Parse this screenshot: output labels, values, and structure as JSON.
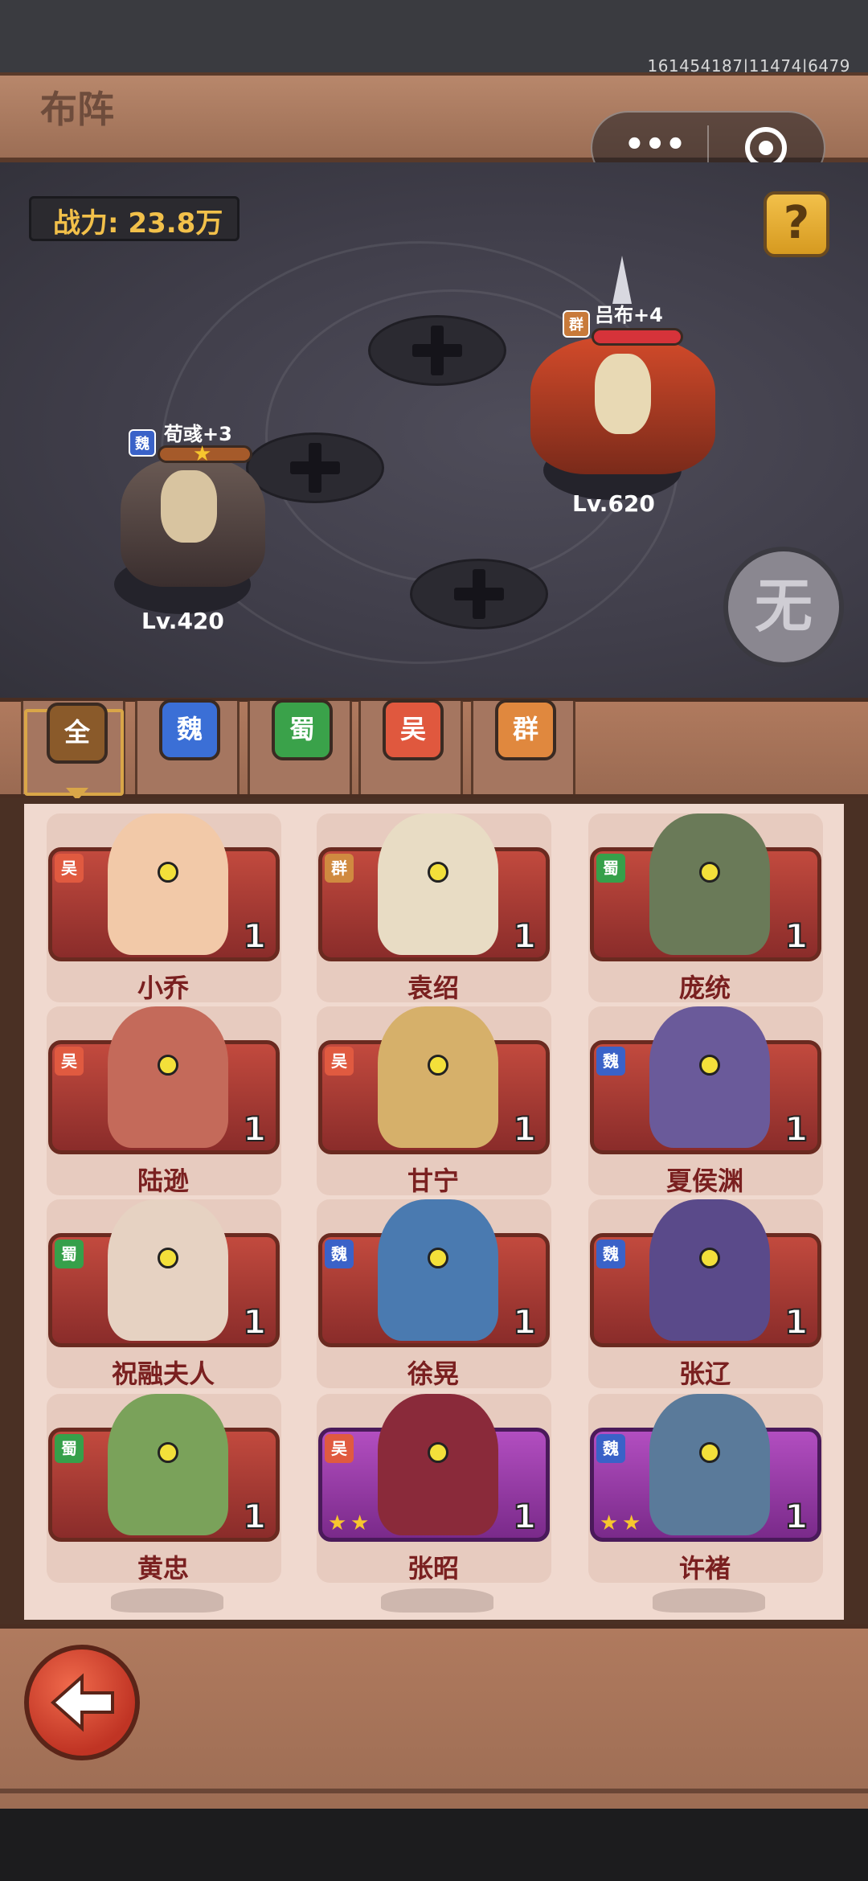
{
  "debug": {
    "text": "161454187|11474|6479"
  },
  "header": {
    "title": "布阵"
  },
  "capsule": {
    "more_glyph": "•••"
  },
  "battle": {
    "power_label": "战力: 23.8万",
    "help_glyph": "?",
    "seal_glyph": "无",
    "heroes": [
      {
        "name": "荀彧+3",
        "faction": "魏",
        "level": "Lv.420",
        "stars": 1,
        "faction_color": "#3a62c8"
      },
      {
        "name": "吕布+4",
        "faction": "群",
        "level": "Lv.620",
        "stars": 0,
        "faction_color": "#c87a3a"
      }
    ]
  },
  "tabs": [
    {
      "label": "全",
      "color": "#8a5a2a",
      "selected": true
    },
    {
      "label": "魏",
      "color": "#3b6fd6"
    },
    {
      "label": "蜀",
      "color": "#3aa24a"
    },
    {
      "label": "吴",
      "color": "#e0583e"
    },
    {
      "label": "群",
      "color": "#e0883e"
    }
  ],
  "faction_colors": {
    "魏": "#3a62c8",
    "蜀": "#36a04a",
    "吴": "#e05a40",
    "群": "#d08a40"
  },
  "cards": [
    {
      "name": "小乔",
      "faction": "吴",
      "count": "1",
      "stars": 0,
      "style": "red"
    },
    {
      "name": "袁绍",
      "faction": "群",
      "count": "1",
      "stars": 0,
      "style": "red"
    },
    {
      "name": "庞统",
      "faction": "蜀",
      "count": "1",
      "stars": 0,
      "style": "red"
    },
    {
      "name": "陆逊",
      "faction": "吴",
      "count": "1",
      "stars": 0,
      "style": "red"
    },
    {
      "name": "甘宁",
      "faction": "吴",
      "count": "1",
      "stars": 0,
      "style": "red"
    },
    {
      "name": "夏侯渊",
      "faction": "魏",
      "count": "1",
      "stars": 0,
      "style": "red"
    },
    {
      "name": "祝融夫人",
      "faction": "蜀",
      "count": "1",
      "stars": 0,
      "style": "red"
    },
    {
      "name": "徐晃",
      "faction": "魏",
      "count": "1",
      "stars": 0,
      "style": "red"
    },
    {
      "name": "张辽",
      "faction": "魏",
      "count": "1",
      "stars": 0,
      "style": "red"
    },
    {
      "name": "黄忠",
      "faction": "蜀",
      "count": "1",
      "stars": 0,
      "style": "red"
    },
    {
      "name": "张昭",
      "faction": "吴",
      "count": "1",
      "stars": 2,
      "style": "purple"
    },
    {
      "name": "许褚",
      "faction": "魏",
      "count": "1",
      "stars": 2,
      "style": "purple"
    }
  ]
}
